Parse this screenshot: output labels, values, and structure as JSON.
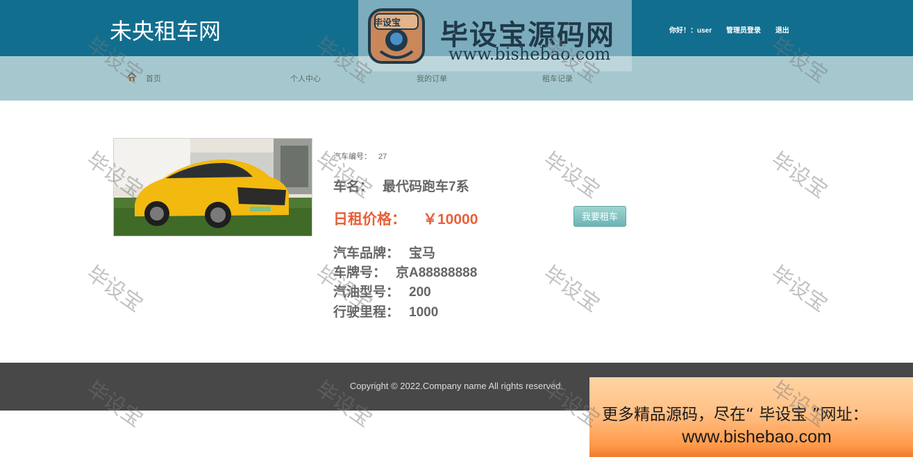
{
  "header": {
    "site_title": "未央租车网",
    "greeting": "你好！：user",
    "admin_login": "管理员登录",
    "logout": "退出"
  },
  "nav": {
    "items": [
      {
        "label": "首页"
      },
      {
        "label": "个人中心"
      },
      {
        "label": "我的订单"
      },
      {
        "label": "租车记录"
      }
    ]
  },
  "banner": {
    "badge_text": "毕设宝",
    "name": "毕设宝源码网",
    "url": "www.bishebao.com"
  },
  "car": {
    "id_label": "汽车编号：",
    "id_value": "27",
    "name_label": "车名：",
    "name_value": "最代码跑车7系",
    "price_label": "日租价格：",
    "price_value": "￥10000",
    "rent_button": "我要租车",
    "brand_label": "汽车品牌：",
    "brand_value": "宝马",
    "plate_label": "车牌号：",
    "plate_value": "京A88888888",
    "fuel_label": "汽油型号：",
    "fuel_value": "200",
    "mileage_label": "行驶里程：",
    "mileage_value": "1000"
  },
  "footer": {
    "copyright": "Copyright © 2022.Company name All rights reserved."
  },
  "promo": {
    "line1": "更多精品源码，尽在“ 毕设宝 ”网址：",
    "line2": "www.bishebao.com"
  },
  "watermark": "毕设宝",
  "colors": {
    "header_bg": "#126e8e",
    "nav_bg": "#a5c8cf",
    "price": "#e85f37",
    "footer_bg": "#484848",
    "car_body": "#f2b90f"
  }
}
